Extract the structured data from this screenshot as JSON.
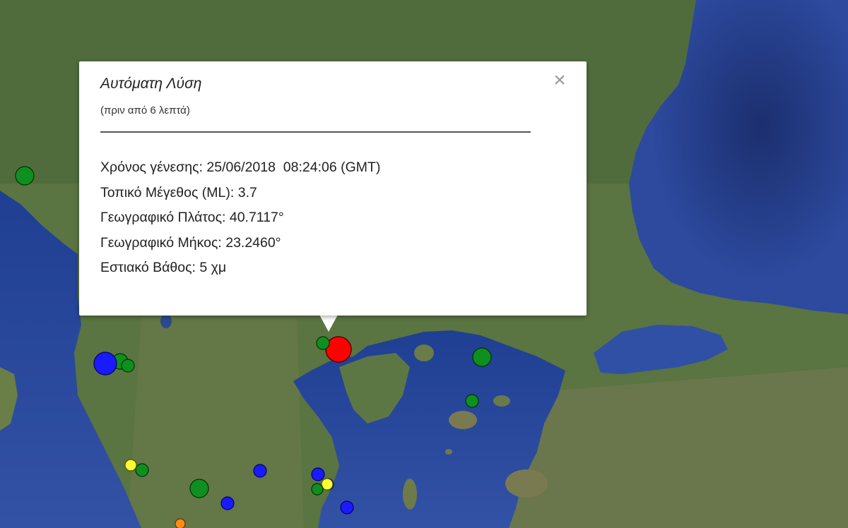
{
  "popup": {
    "title": "Αυτόματη Λύση",
    "subtitle": "(πριν από 6 λεπτά)",
    "close_symbol": "×",
    "close_icon": "close-icon",
    "details": [
      {
        "label": "Χρόνος γένεσης",
        "value": "25/06/2018  08:24:06 (GMT)"
      },
      {
        "label": "Τοπικό Μέγεθος (ML)",
        "value": "3.7"
      },
      {
        "label": "Γεωγραφικό Πλάτος",
        "value": "40.7117°"
      },
      {
        "label": "Γεωγραφικό Μήκος",
        "value": "23.2460°"
      },
      {
        "label": "Εστιακό Βάθος",
        "value": "5 χμ"
      }
    ]
  },
  "map": {
    "type": "satellite",
    "colors": {
      "sea": "#2b4a9b",
      "land": "#4a6b3a",
      "marker_red": "#ff0000",
      "marker_green": "#0f8f1f",
      "marker_blue": "#1a1aff",
      "marker_yellow": "#ffff33",
      "marker_orange": "#ff8c1a"
    },
    "markers": [
      {
        "color": "red",
        "selected": true
      },
      {
        "color": "green"
      },
      {
        "color": "green"
      },
      {
        "color": "green"
      },
      {
        "color": "green"
      },
      {
        "color": "green"
      },
      {
        "color": "green"
      },
      {
        "color": "green"
      },
      {
        "color": "green"
      },
      {
        "color": "blue"
      },
      {
        "color": "blue"
      },
      {
        "color": "blue"
      },
      {
        "color": "blue"
      },
      {
        "color": "blue"
      },
      {
        "color": "blue"
      },
      {
        "color": "yellow"
      },
      {
        "color": "yellow"
      },
      {
        "color": "orange"
      },
      {
        "color": "green"
      }
    ]
  }
}
